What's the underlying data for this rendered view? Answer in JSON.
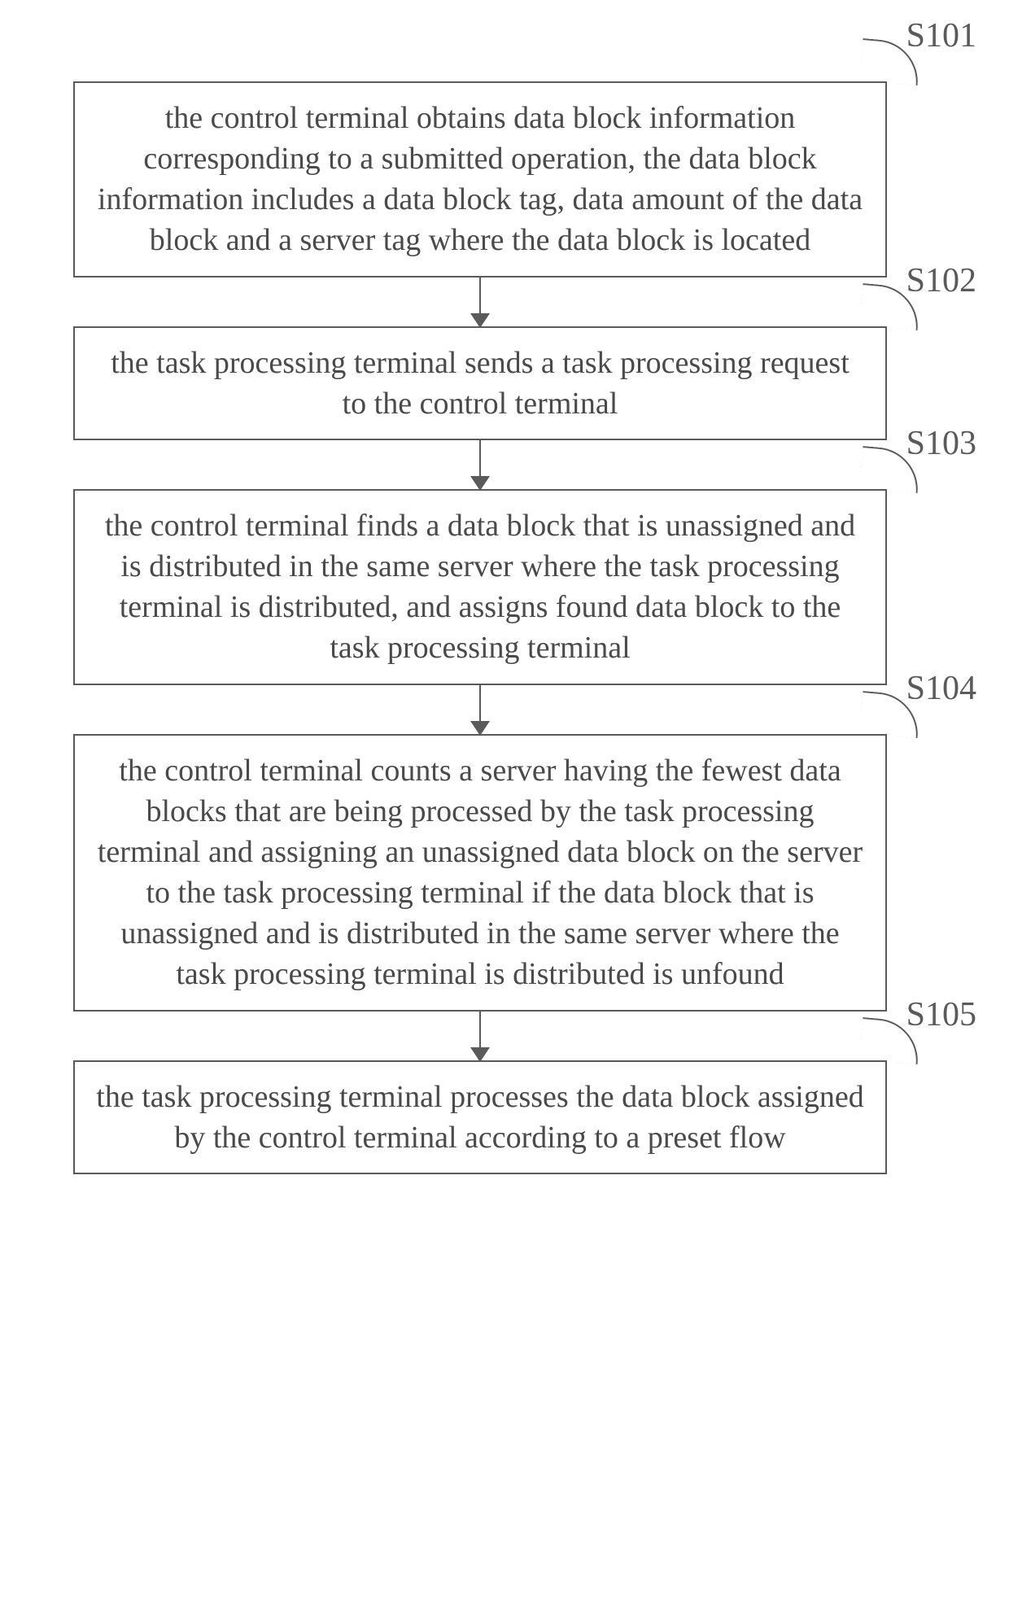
{
  "flowchart": {
    "steps": [
      {
        "id": "S101",
        "text": "the control terminal obtains data block information corresponding to a submitted operation, the data block information includes a data block tag, data amount of the data block and a server tag where the data block is located"
      },
      {
        "id": "S102",
        "text": "the task processing terminal sends a task processing request to the control terminal"
      },
      {
        "id": "S103",
        "text": "the control terminal finds a data block that is unassigned and is distributed in the same server where the task processing terminal is distributed, and assigns found data block to the task processing terminal"
      },
      {
        "id": "S104",
        "text": "the control terminal counts a server having the fewest data blocks that are being processed by the task processing terminal and assigning an unassigned data block on the server to the task processing terminal if the data block that is unassigned and is distributed in the same server where the task processing terminal is distributed is unfound"
      },
      {
        "id": "S105",
        "text": "the task processing terminal processes the data block assigned by the control terminal according to a preset flow"
      }
    ]
  }
}
